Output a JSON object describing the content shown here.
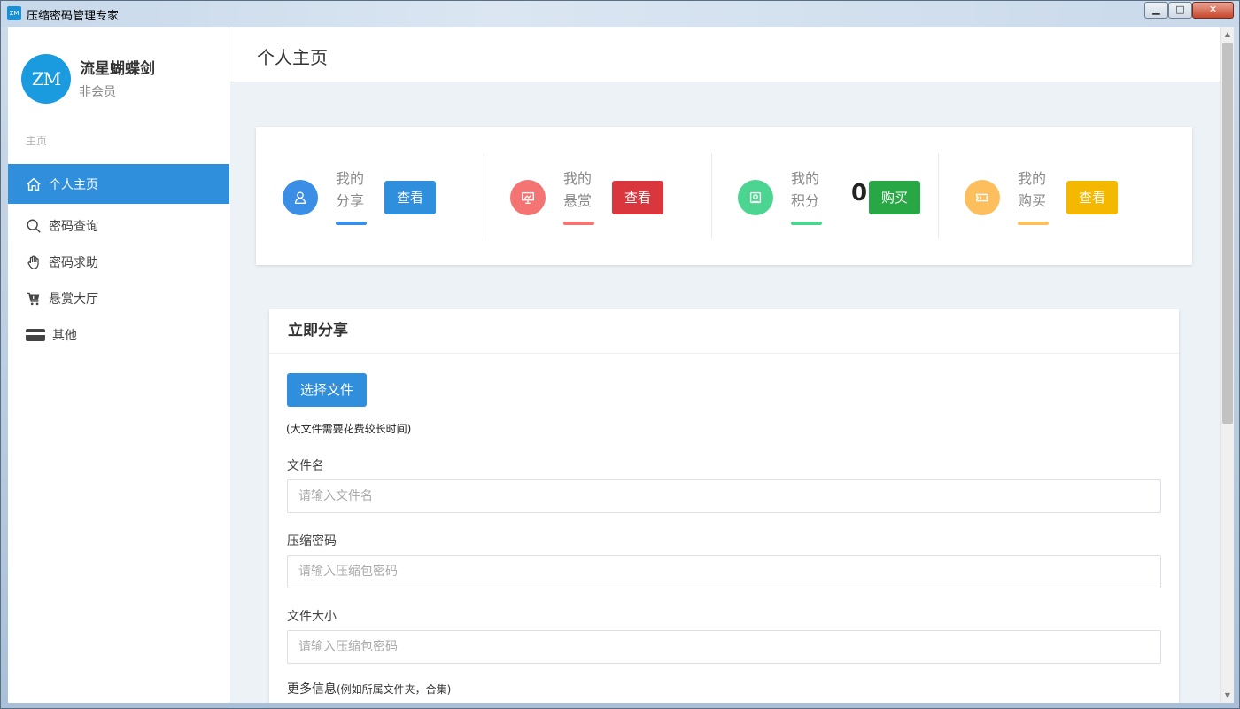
{
  "window": {
    "icon_text": "ZM",
    "title": "压缩密码管理专家",
    "minimize": "▁",
    "maximize": "□",
    "close": "✕"
  },
  "sidebar": {
    "avatar_text": "ZM",
    "username": "流星蝴蝶剑",
    "membership": "非会员",
    "section_label": "主页",
    "items": [
      {
        "label": "个人主页",
        "icon": "home-icon",
        "active": true
      },
      {
        "label": "密码查询",
        "icon": "search-icon",
        "active": false
      },
      {
        "label": "密码求助",
        "icon": "hand-icon",
        "active": false
      },
      {
        "label": "悬赏大厅",
        "icon": "cart-icon",
        "active": false
      },
      {
        "label": "其他",
        "icon": "card-icon",
        "active": false
      }
    ]
  },
  "page": {
    "title": "个人主页"
  },
  "stats": [
    {
      "label_line1": "我的",
      "label_line2": "分享",
      "value": "",
      "button": "查看",
      "icon": "user-icon",
      "icon_color": "#3b8ee6",
      "underline_color": "#3b8ee6",
      "button_color": "#2f8fdc"
    },
    {
      "label_line1": "我的",
      "label_line2": "悬赏",
      "value": "",
      "button": "查看",
      "icon": "presentation-icon",
      "icon_color": "#f47373",
      "underline_color": "#f47373",
      "button_color": "#d9363e"
    },
    {
      "label_line1": "我的",
      "label_line2": "积分",
      "value": "0",
      "button": "购买",
      "icon": "badge-icon",
      "icon_color": "#4cd590",
      "underline_color": "#4cd590",
      "button_color": "#28a745"
    },
    {
      "label_line1": "我的",
      "label_line2": "购买",
      "value": "",
      "button": "查看",
      "icon": "ticket-icon",
      "icon_color": "#fdbf5e",
      "underline_color": "#fdbf5e",
      "button_color": "#f5b800"
    }
  ],
  "share": {
    "title": "立即分享",
    "choose_file": "选择文件",
    "hint": "(大文件需要花费较长时间)",
    "fields": [
      {
        "label": "文件名",
        "placeholder": "请输入文件名"
      },
      {
        "label": "压缩密码",
        "placeholder": "请输入压缩包密码"
      },
      {
        "label": "文件大小",
        "placeholder": "请输入压缩包密码"
      }
    ],
    "more_label": "更多信息",
    "more_hint": "(例如所属文件夹，合集)"
  }
}
